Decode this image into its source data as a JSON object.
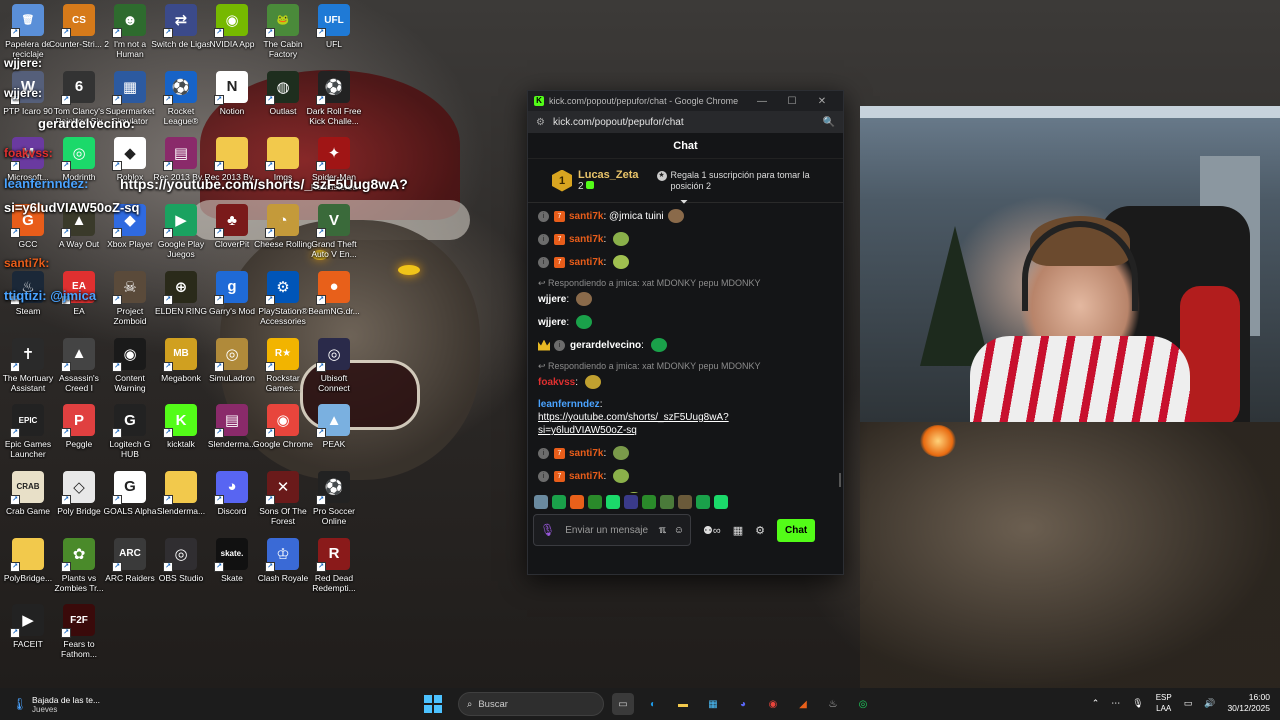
{
  "desktop": {
    "icons": [
      {
        "label": "Papelera de reciclaje",
        "icon": "recycle-bin-icon",
        "color": "#5a8fd8",
        "glyph": "🗑"
      },
      {
        "label": "Counter-Stri... 2",
        "icon": "cs2-icon",
        "color": "#d67a1a",
        "glyph": "CS"
      },
      {
        "label": "I'm not a Human",
        "icon": "game-icon",
        "color": "#2e6b2e",
        "glyph": "☻"
      },
      {
        "label": "Switch de Ligas",
        "icon": "switch-icon",
        "color": "#3b4a8a",
        "glyph": "⇄"
      },
      {
        "label": "NVIDIA App",
        "icon": "nvidia-icon",
        "color": "#76b900",
        "glyph": "◉"
      },
      {
        "label": "The Cabin Factory",
        "icon": "frog-icon",
        "color": "#4a8a3a",
        "glyph": "🐸"
      },
      {
        "label": "UFL",
        "icon": "ufl-icon",
        "color": "#1f7ad6",
        "glyph": "UFL"
      },
      {
        "label": "PTP Icaro 90",
        "icon": "ptp-icon",
        "color": "#555f7a",
        "glyph": "W"
      },
      {
        "label": "Tom Clancy's Rainbow Six",
        "icon": "r6-icon",
        "color": "#333",
        "glyph": "6"
      },
      {
        "label": "Supermarket Simulator",
        "icon": "store-icon",
        "color": "#2c5aa0",
        "glyph": "▦"
      },
      {
        "label": "Rocket League®",
        "icon": "rocket-league-icon",
        "color": "#1763c7",
        "glyph": "⚽"
      },
      {
        "label": "Notion",
        "icon": "notion-icon",
        "color": "#ffffff",
        "glyph": "N"
      },
      {
        "label": "Outlast",
        "icon": "outlast-icon",
        "color": "#1e2e1e",
        "glyph": "◍"
      },
      {
        "label": "Dark Roll Free Kick Challe...",
        "icon": "ball-icon",
        "color": "#222",
        "glyph": "⚽"
      },
      {
        "label": "Microsoft...",
        "icon": "edge-icon",
        "color": "#6a3aa0",
        "glyph": "M"
      },
      {
        "label": "Modrinth",
        "icon": "modrinth-icon",
        "color": "#1bd96a",
        "glyph": "◎"
      },
      {
        "label": "Roblox",
        "icon": "roblox-icon",
        "color": "#ffffff",
        "glyph": "◆"
      },
      {
        "label": "Rec 2013 By...",
        "icon": "winrar-icon",
        "color": "#8a2a6a",
        "glyph": "▤"
      },
      {
        "label": "Rec 2013 By...",
        "icon": "folder-icon",
        "color": "#f2c94c",
        "glyph": ""
      },
      {
        "label": "Imgs",
        "icon": "folder-icon",
        "color": "#f2c94c",
        "glyph": ""
      },
      {
        "label": "Spider-Man Remastered",
        "icon": "spiderman-icon",
        "color": "#a01515",
        "glyph": "✦"
      },
      {
        "label": "GCC",
        "icon": "gcc-icon",
        "color": "#e85d1a",
        "glyph": "G"
      },
      {
        "label": "A Way Out",
        "icon": "awayout-icon",
        "color": "#3a3a2a",
        "glyph": "▲"
      },
      {
        "label": "Xbox Player",
        "icon": "xbox-icon",
        "color": "#2f6ae0",
        "glyph": "◆"
      },
      {
        "label": "Google Play Juegos",
        "icon": "play-games-icon",
        "color": "#1aa260",
        "glyph": "▶"
      },
      {
        "label": "CloverPit",
        "icon": "cloverpit-icon",
        "color": "#7a1a1a",
        "glyph": "♣"
      },
      {
        "label": "Cheese Rolling",
        "icon": "cheese-icon",
        "color": "#c49a3a",
        "glyph": "◔"
      },
      {
        "label": "Grand Theft Auto V En...",
        "icon": "gta-icon",
        "color": "#3a6a3a",
        "glyph": "V"
      },
      {
        "label": "Steam",
        "icon": "steam-icon",
        "color": "#1b2838",
        "glyph": "♨"
      },
      {
        "label": "EA",
        "icon": "ea-icon",
        "color": "#e03030",
        "glyph": "EA"
      },
      {
        "label": "Project Zomboid",
        "icon": "zomboid-icon",
        "color": "#5a4a3a",
        "glyph": "☠"
      },
      {
        "label": "ELDEN RING",
        "icon": "elden-ring-icon",
        "color": "#2a2a1a",
        "glyph": "⊕"
      },
      {
        "label": "Garry's Mod",
        "icon": "gmod-icon",
        "color": "#1f6ad6",
        "glyph": "g"
      },
      {
        "label": "PlayStation® Accessories",
        "icon": "playstation-icon",
        "color": "#0055b8",
        "glyph": "⚙"
      },
      {
        "label": "BeamNG.dr...",
        "icon": "beamng-icon",
        "color": "#e8601a",
        "glyph": "●"
      },
      {
        "label": "The Mortuary Assistant",
        "icon": "mortuary-icon",
        "color": "#2a2a2a",
        "glyph": "✝"
      },
      {
        "label": "Assassin's Creed I",
        "icon": "assassins-icon",
        "color": "#444",
        "glyph": "▲"
      },
      {
        "label": "Content Warning",
        "icon": "content-warning-icon",
        "color": "#1a1a1a",
        "glyph": "◉"
      },
      {
        "label": "Megabonk",
        "icon": "megabonk-icon",
        "color": "#d0a020",
        "glyph": "MB"
      },
      {
        "label": "SimuLadron",
        "icon": "simuladron-icon",
        "color": "#b08a3a",
        "glyph": "◎"
      },
      {
        "label": "Rockstar Games...",
        "icon": "rockstar-icon",
        "color": "#f2b400",
        "glyph": "R★"
      },
      {
        "label": "Ubisoft Connect",
        "icon": "ubisoft-icon",
        "color": "#2a2a4a",
        "glyph": "◎"
      },
      {
        "label": "Epic Games Launcher",
        "icon": "epic-icon",
        "color": "#222",
        "glyph": "EPIC"
      },
      {
        "label": "Peggle",
        "icon": "peggle-icon",
        "color": "#e04040",
        "glyph": "P"
      },
      {
        "label": "Logitech G HUB",
        "icon": "logitech-icon",
        "color": "#222",
        "glyph": "G"
      },
      {
        "label": "kicktalk",
        "icon": "kicktalk-icon",
        "color": "#53fc18",
        "glyph": "K"
      },
      {
        "label": "Slenderma...",
        "icon": "winrar-icon",
        "color": "#8a2a6a",
        "glyph": "▤"
      },
      {
        "label": "Google Chrome",
        "icon": "chrome-icon",
        "color": "#e8453c",
        "glyph": "◉"
      },
      {
        "label": "PEAK",
        "icon": "peak-icon",
        "color": "#7ab0e0",
        "glyph": "▲"
      },
      {
        "label": "Crab Game",
        "icon": "crab-game-icon",
        "color": "#e8e0c8",
        "glyph": "CRAB"
      },
      {
        "label": "Poly Bridge",
        "icon": "polybridge-icon",
        "color": "#e8e8e8",
        "glyph": "◇"
      },
      {
        "label": "GOALS Alpha",
        "icon": "goals-icon",
        "color": "#ffffff",
        "glyph": "G"
      },
      {
        "label": "Slenderma...",
        "icon": "folder-icon",
        "color": "#f2c94c",
        "glyph": ""
      },
      {
        "label": "Discord",
        "icon": "discord-icon",
        "color": "#5865f2",
        "glyph": "◕"
      },
      {
        "label": "Sons Of The Forest",
        "icon": "sons-forest-icon",
        "color": "#6a1a1a",
        "glyph": "✕"
      },
      {
        "label": "Pro Soccer Online",
        "icon": "pro-soccer-icon",
        "color": "#222",
        "glyph": "⚽"
      },
      {
        "label": "PolyBridge...",
        "icon": "folder-icon",
        "color": "#f2c94c",
        "glyph": ""
      },
      {
        "label": "Plants vs Zombies Tr...",
        "icon": "pvz-icon",
        "color": "#4a8a2a",
        "glyph": "✿"
      },
      {
        "label": "ARC Raiders",
        "icon": "arc-raiders-icon",
        "color": "#3a3a3a",
        "glyph": "ARC"
      },
      {
        "label": "OBS Studio",
        "icon": "obs-icon",
        "color": "#302e31",
        "glyph": "◎"
      },
      {
        "label": "Skate",
        "icon": "skate-icon",
        "color": "#111",
        "glyph": "skate."
      },
      {
        "label": "Clash Royale",
        "icon": "clash-royale-icon",
        "color": "#3a6ad6",
        "glyph": "♔"
      },
      {
        "label": "Red Dead Redempti...",
        "icon": "rdr-icon",
        "color": "#8a1a1a",
        "glyph": "R"
      },
      {
        "label": "FACEIT",
        "icon": "faceit-icon",
        "color": "#222",
        "glyph": "▶"
      },
      {
        "label": "Fears to Fathom...",
        "icon": "f2f-icon",
        "color": "#3a0a0a",
        "glyph": "F2F"
      }
    ]
  },
  "overlay": {
    "lines": [
      {
        "text": "wjjere:",
        "color": "#ffffff"
      },
      {
        "text": "wjjere:",
        "color": "#ffffff"
      },
      {
        "text": "gerardelvecino:",
        "color": "#ffffff"
      },
      {
        "text": "foakvss:",
        "color": "#e03030"
      },
      {
        "text": "leanfernndez:",
        "color": "#4aa3ff"
      },
      {
        "text": "https://youtube.com/shorts/_szF5Uug8wA?",
        "color": "#ffffff"
      },
      {
        "text": "si=y6ludVIAW50oZ-sq",
        "color": "#ffffff"
      },
      {
        "text": "santi7k:",
        "color": "#e85d1a"
      },
      {
        "text": "ttiqtizi: @jmica",
        "color": "#4aa3ff"
      }
    ]
  },
  "browser": {
    "title": "kick.com/popout/pepufor/chat - Google Chrome",
    "url": "kick.com/popout/pepufor/chat",
    "chat_title": "Chat",
    "pinned": {
      "rank": "1",
      "user": "Lucas_Zeta",
      "subs": "2",
      "gift_text": "Regala 1 suscripción para tomar la posición 2"
    },
    "messages": [
      {
        "reply": "",
        "user": "santi7k",
        "color": "#e85d1a",
        "badges": "sub",
        "text": "@jmica tuini"
      },
      {
        "reply": "",
        "user": "santi7k",
        "color": "#e85d1a",
        "badges": "sub",
        "text": ""
      },
      {
        "reply": "",
        "user": "santi7k",
        "color": "#e85d1a",
        "badges": "sub",
        "text": ""
      },
      {
        "reply": "Respondiendo a jmica: xat MDONKY pepu MDONKY",
        "user": "wjjere",
        "color": "#ffffff",
        "badges": "",
        "text": ""
      },
      {
        "reply": "",
        "user": "wjjere",
        "color": "#ffffff",
        "badges": "",
        "text": ""
      },
      {
        "reply": "",
        "user": "gerardelvecino",
        "color": "#ffffff",
        "badges": "crown",
        "text": ""
      },
      {
        "reply": "Respondiendo a jmica: xat MDONKY pepu MDONKY",
        "user": "foakvss",
        "color": "#e03030",
        "badges": "",
        "text": ""
      },
      {
        "reply": "",
        "user": "leanfernndez",
        "color": "#4aa3ff",
        "badges": "",
        "text": "https://youtube.com/shorts/_szF5Uug8wA?si=y6ludVIAW50oZ-sq"
      },
      {
        "reply": "",
        "user": "santi7k",
        "color": "#e85d1a",
        "badges": "sub",
        "text": ""
      },
      {
        "reply": "",
        "user": "santi7k",
        "color": "#e85d1a",
        "badges": "sub",
        "text": ""
      },
      {
        "reply": "",
        "user": "ttiqtizi",
        "color": "#4aa3ff",
        "badges": "verified",
        "text": "@jmica"
      }
    ],
    "input_placeholder": "Enviar un mensaje",
    "send_label": "Chat"
  },
  "taskbar": {
    "weather_title": "Bajada de las te...",
    "weather_sub": "Jueves",
    "search_placeholder": "Buscar",
    "lang_top": "ESP",
    "lang_bottom": "LAA",
    "time": "16:00",
    "date": "30/12/2025"
  },
  "colors": {
    "kick_green": "#53fc18",
    "accent_blue": "#4cc2ff"
  }
}
